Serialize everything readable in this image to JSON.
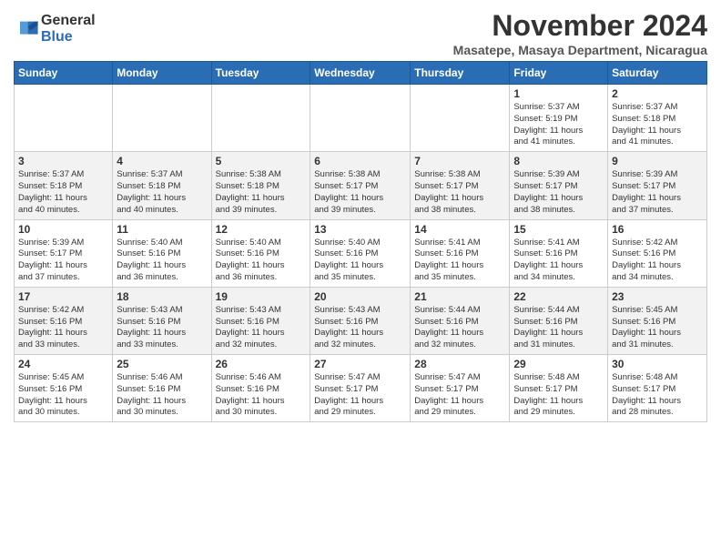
{
  "header": {
    "logo_general": "General",
    "logo_blue": "Blue",
    "month_title": "November 2024",
    "location": "Masatepe, Masaya Department, Nicaragua"
  },
  "days_of_week": [
    "Sunday",
    "Monday",
    "Tuesday",
    "Wednesday",
    "Thursday",
    "Friday",
    "Saturday"
  ],
  "weeks": [
    [
      {
        "day": "",
        "info": ""
      },
      {
        "day": "",
        "info": ""
      },
      {
        "day": "",
        "info": ""
      },
      {
        "day": "",
        "info": ""
      },
      {
        "day": "",
        "info": ""
      },
      {
        "day": "1",
        "info": "Sunrise: 5:37 AM\nSunset: 5:19 PM\nDaylight: 11 hours\nand 41 minutes."
      },
      {
        "day": "2",
        "info": "Sunrise: 5:37 AM\nSunset: 5:18 PM\nDaylight: 11 hours\nand 41 minutes."
      }
    ],
    [
      {
        "day": "3",
        "info": "Sunrise: 5:37 AM\nSunset: 5:18 PM\nDaylight: 11 hours\nand 40 minutes."
      },
      {
        "day": "4",
        "info": "Sunrise: 5:37 AM\nSunset: 5:18 PM\nDaylight: 11 hours\nand 40 minutes."
      },
      {
        "day": "5",
        "info": "Sunrise: 5:38 AM\nSunset: 5:18 PM\nDaylight: 11 hours\nand 39 minutes."
      },
      {
        "day": "6",
        "info": "Sunrise: 5:38 AM\nSunset: 5:17 PM\nDaylight: 11 hours\nand 39 minutes."
      },
      {
        "day": "7",
        "info": "Sunrise: 5:38 AM\nSunset: 5:17 PM\nDaylight: 11 hours\nand 38 minutes."
      },
      {
        "day": "8",
        "info": "Sunrise: 5:39 AM\nSunset: 5:17 PM\nDaylight: 11 hours\nand 38 minutes."
      },
      {
        "day": "9",
        "info": "Sunrise: 5:39 AM\nSunset: 5:17 PM\nDaylight: 11 hours\nand 37 minutes."
      }
    ],
    [
      {
        "day": "10",
        "info": "Sunrise: 5:39 AM\nSunset: 5:17 PM\nDaylight: 11 hours\nand 37 minutes."
      },
      {
        "day": "11",
        "info": "Sunrise: 5:40 AM\nSunset: 5:16 PM\nDaylight: 11 hours\nand 36 minutes."
      },
      {
        "day": "12",
        "info": "Sunrise: 5:40 AM\nSunset: 5:16 PM\nDaylight: 11 hours\nand 36 minutes."
      },
      {
        "day": "13",
        "info": "Sunrise: 5:40 AM\nSunset: 5:16 PM\nDaylight: 11 hours\nand 35 minutes."
      },
      {
        "day": "14",
        "info": "Sunrise: 5:41 AM\nSunset: 5:16 PM\nDaylight: 11 hours\nand 35 minutes."
      },
      {
        "day": "15",
        "info": "Sunrise: 5:41 AM\nSunset: 5:16 PM\nDaylight: 11 hours\nand 34 minutes."
      },
      {
        "day": "16",
        "info": "Sunrise: 5:42 AM\nSunset: 5:16 PM\nDaylight: 11 hours\nand 34 minutes."
      }
    ],
    [
      {
        "day": "17",
        "info": "Sunrise: 5:42 AM\nSunset: 5:16 PM\nDaylight: 11 hours\nand 33 minutes."
      },
      {
        "day": "18",
        "info": "Sunrise: 5:43 AM\nSunset: 5:16 PM\nDaylight: 11 hours\nand 33 minutes."
      },
      {
        "day": "19",
        "info": "Sunrise: 5:43 AM\nSunset: 5:16 PM\nDaylight: 11 hours\nand 32 minutes."
      },
      {
        "day": "20",
        "info": "Sunrise: 5:43 AM\nSunset: 5:16 PM\nDaylight: 11 hours\nand 32 minutes."
      },
      {
        "day": "21",
        "info": "Sunrise: 5:44 AM\nSunset: 5:16 PM\nDaylight: 11 hours\nand 32 minutes."
      },
      {
        "day": "22",
        "info": "Sunrise: 5:44 AM\nSunset: 5:16 PM\nDaylight: 11 hours\nand 31 minutes."
      },
      {
        "day": "23",
        "info": "Sunrise: 5:45 AM\nSunset: 5:16 PM\nDaylight: 11 hours\nand 31 minutes."
      }
    ],
    [
      {
        "day": "24",
        "info": "Sunrise: 5:45 AM\nSunset: 5:16 PM\nDaylight: 11 hours\nand 30 minutes."
      },
      {
        "day": "25",
        "info": "Sunrise: 5:46 AM\nSunset: 5:16 PM\nDaylight: 11 hours\nand 30 minutes."
      },
      {
        "day": "26",
        "info": "Sunrise: 5:46 AM\nSunset: 5:16 PM\nDaylight: 11 hours\nand 30 minutes."
      },
      {
        "day": "27",
        "info": "Sunrise: 5:47 AM\nSunset: 5:17 PM\nDaylight: 11 hours\nand 29 minutes."
      },
      {
        "day": "28",
        "info": "Sunrise: 5:47 AM\nSunset: 5:17 PM\nDaylight: 11 hours\nand 29 minutes."
      },
      {
        "day": "29",
        "info": "Sunrise: 5:48 AM\nSunset: 5:17 PM\nDaylight: 11 hours\nand 29 minutes."
      },
      {
        "day": "30",
        "info": "Sunrise: 5:48 AM\nSunset: 5:17 PM\nDaylight: 11 hours\nand 28 minutes."
      }
    ]
  ]
}
